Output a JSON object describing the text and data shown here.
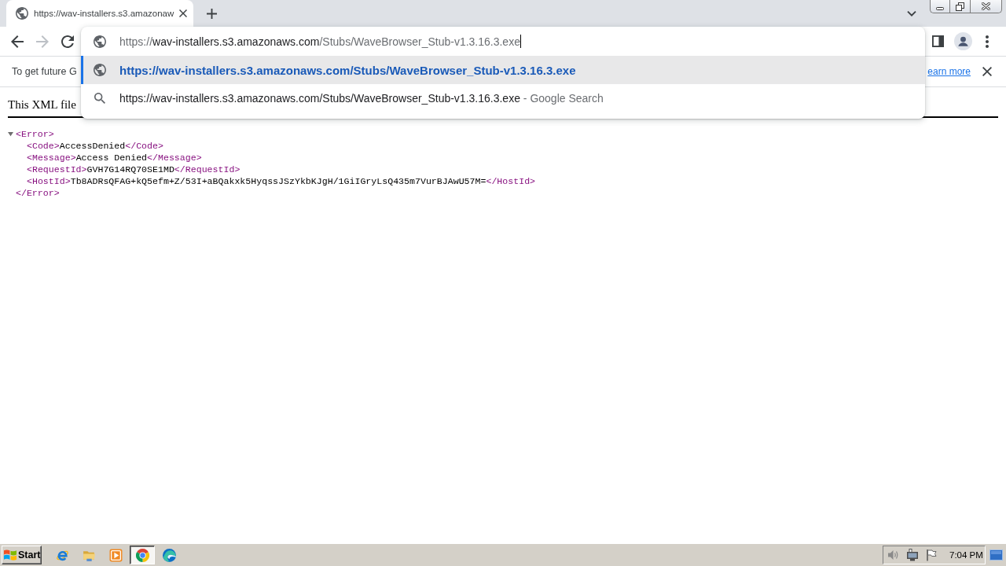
{
  "tabs": [
    {
      "title": "https://wav-installers.s3.amazonaw",
      "selected": true
    }
  ],
  "toolbar": {
    "nav_buttons": [
      {
        "kind": "back",
        "disabled": false
      },
      {
        "kind": "forward",
        "disabled": true
      },
      {
        "kind": "reload",
        "disabled": false
      }
    ]
  },
  "omnibox": {
    "value_parts": [
      {
        "text": "https://",
        "emphasized": false
      },
      {
        "text": "wav-installers.s3.amazonaws.com",
        "emphasized": true
      },
      {
        "text": "/Stubs/WaveBrowser_Stub-v1.3.16.3.exe",
        "emphasized": false
      }
    ],
    "suggestions": [
      {
        "kind": "url",
        "text": "https://wav-installers.s3.amazonaws.com/Stubs/WaveBrowser_Stub-v1.3.16.3.exe",
        "selected": true
      },
      {
        "kind": "search",
        "text": "https://wav-installers.s3.amazonaws.com/Stubs/WaveBrowser_Stub-v1.3.16.3.exe",
        "suffix": "- Google Search",
        "selected": false
      }
    ]
  },
  "infobar": {
    "message": "To get future G",
    "link": "earn more"
  },
  "page": {
    "heading": "This XML file",
    "tree": {
      "open": "<Error>",
      "close": "</Error>",
      "expanded": true,
      "children": [
        {
          "open": "<Code>",
          "text": "AccessDenied",
          "close": "</Code>"
        },
        {
          "open": "<Message>",
          "text": "Access Denied",
          "close": "</Message>"
        },
        {
          "open": "<RequestId>",
          "text": "GVH7G14RQ70SE1MD",
          "close": "</RequestId>"
        },
        {
          "open": "<HostId>",
          "text": "Tb8ADRsQFAG+kQ5efm+Z/53I+aBQakxk5HyqssJSzYkbKJgH/1GiIGryLsQ435m7VurBJAwU57M=",
          "close": "</HostId>"
        }
      ]
    }
  },
  "taskbar": {
    "start": "Start",
    "apps": [
      {
        "kind": "ie",
        "active": false
      },
      {
        "kind": "folder",
        "active": false
      },
      {
        "kind": "media",
        "active": false
      },
      {
        "kind": "chrome",
        "active": true
      },
      {
        "kind": "edge",
        "active": false
      }
    ],
    "clock": "7:04 PM"
  }
}
